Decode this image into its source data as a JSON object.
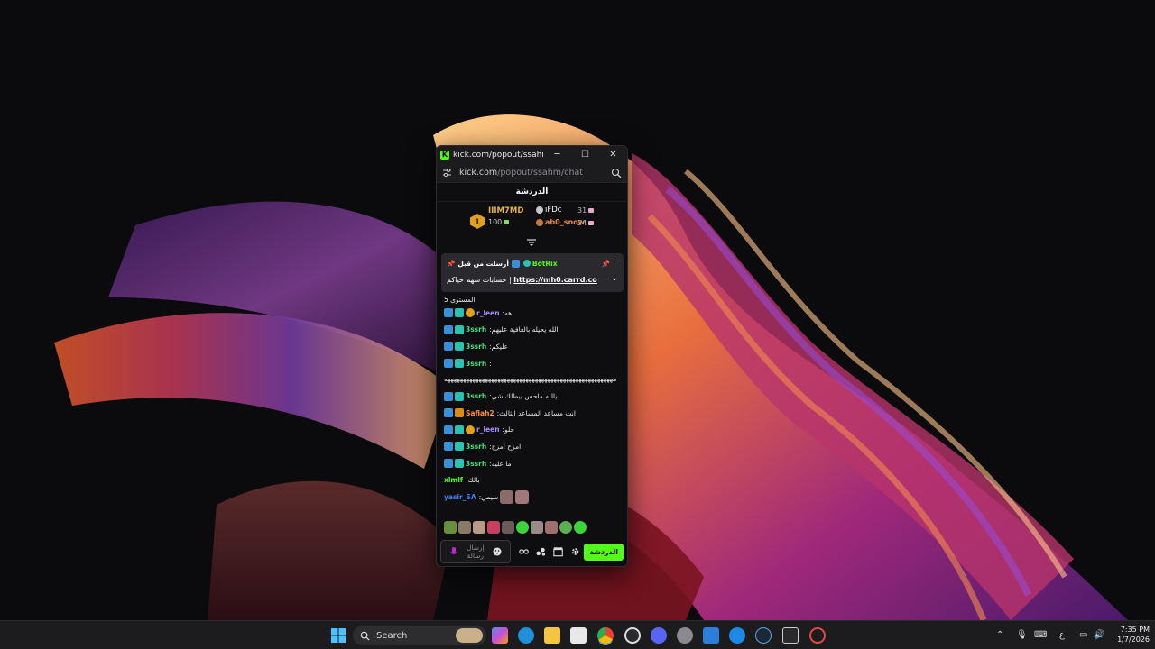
{
  "browser": {
    "window_title": "kick.com/popout/ssahm/ch...",
    "url_host": "kick.com",
    "url_path": "/popout/ssahm/chat",
    "buttons": {
      "minimize": "─",
      "maximize": "☐",
      "close": "✕"
    }
  },
  "chat": {
    "header": "الدردشة",
    "leaderboard": {
      "first": {
        "rank": "1",
        "name": "IIIM7MD",
        "value": "100"
      },
      "second": {
        "name": "iFDc",
        "value": "31"
      },
      "third": {
        "name": "ab0_snow",
        "value": "24"
      }
    },
    "pinned": {
      "label": "أرسلت من قبل",
      "author": "BotRix",
      "text_prefix": "حسابات سهم حياكم |",
      "link": "https://mh0.carrd.co"
    },
    "level_text": "المستوى 5",
    "messages": [
      {
        "user": "r_leen",
        "color": "#a78bfa",
        "text": "هه",
        "badges": [
          "mod",
          "sub",
          "gold"
        ]
      },
      {
        "user": "3ssrh",
        "color": "#4ade80",
        "text": "الله يحيله بالعافية عليهم",
        "badges": [
          "mod",
          "sub"
        ]
      },
      {
        "user": "3ssrh",
        "color": "#4ade80",
        "text": "عليكم",
        "badges": [
          "mod",
          "sub"
        ]
      },
      {
        "user": "3ssrh",
        "color": "#4ade80",
        "text": "",
        "badges": [
          "mod",
          "sub"
        ]
      },
      {
        "user": "3ssrh",
        "color": "#4ade80",
        "text": "يالله ماحس بيطلك شي",
        "badges": [
          "mod",
          "sub"
        ]
      },
      {
        "user": "Safiah2",
        "color": "#fb923c",
        "text": "انت مساعد المساعد الثالث",
        "badges": [
          "mod",
          "vip"
        ]
      },
      {
        "user": "r_leen",
        "color": "#a78bfa",
        "text": "حلو",
        "badges": [
          "mod",
          "sub",
          "gold"
        ]
      },
      {
        "user": "3ssrh",
        "color": "#4ade80",
        "text": "امزح امزح",
        "badges": [
          "mod",
          "sub"
        ]
      },
      {
        "user": "3ssrh",
        "color": "#4ade80",
        "text": "ما عليه",
        "badges": [
          "mod",
          "sub"
        ]
      },
      {
        "user": "xlmlf",
        "color": "#53fc18",
        "text": "بالك",
        "badges": []
      },
      {
        "user": "yasir_SA",
        "color": "#3b82f6",
        "text": "سيمي",
        "badges": []
      }
    ],
    "long_message_text": "ههههههههههههههههههههههههههههههههههههههههههههههههههههههه",
    "input_placeholder": "إرسال رسالة",
    "chat_button": "الدردشة"
  },
  "taskbar": {
    "search_placeholder": "Search",
    "time": "7:35 PM",
    "date": "1/7/2026",
    "lang": "ع"
  },
  "colors": {
    "kick_green": "#53fc18",
    "window_bg": "#0e0e10"
  }
}
